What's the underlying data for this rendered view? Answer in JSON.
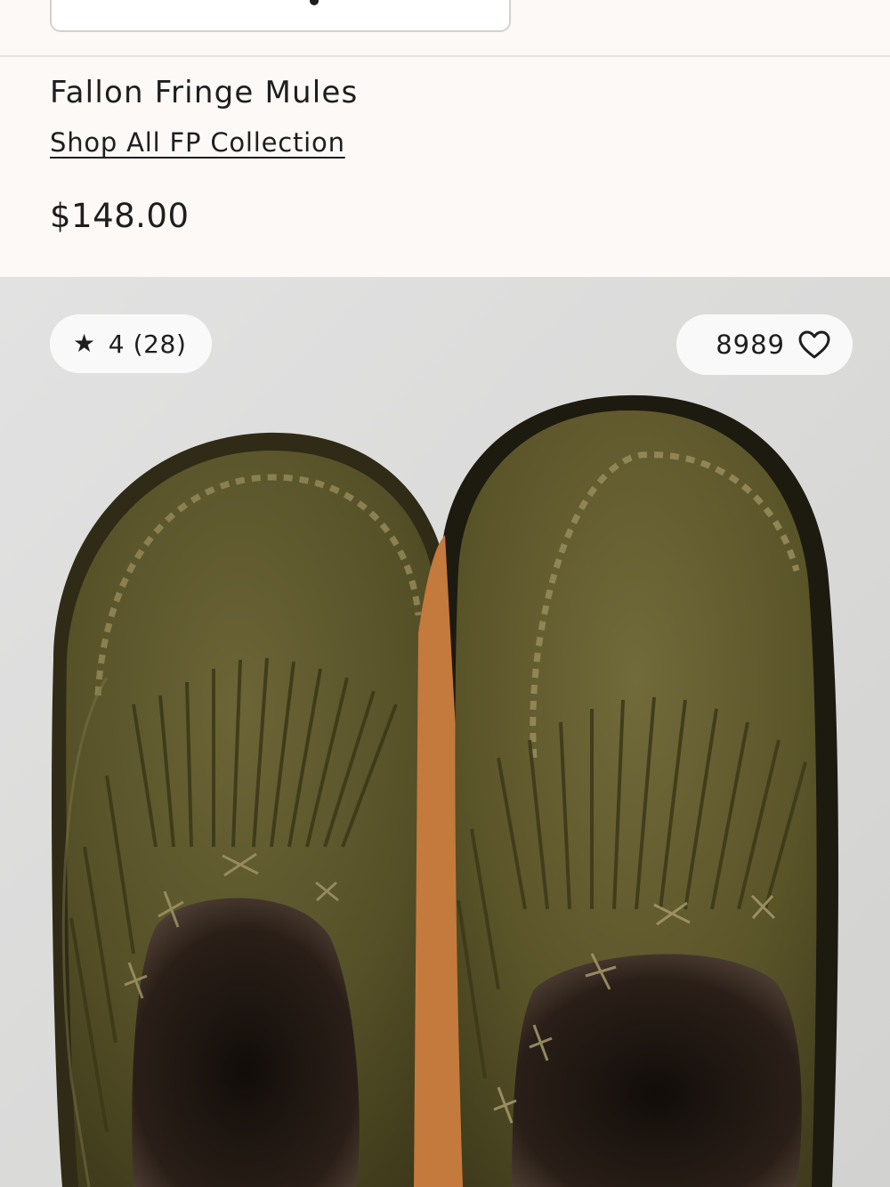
{
  "product": {
    "title": "Fallon Fringe Mules",
    "collection_link": "Shop All FP Collection",
    "price": "$148.00"
  },
  "rating": {
    "star_icon": "star-icon",
    "text": "4 (28)"
  },
  "favorites": {
    "count": "8989",
    "icon": "heart-outline-icon"
  },
  "colors": {
    "page_background": "#fcf9f7",
    "suede": "#4f4a26",
    "sole": "#c47a3c"
  }
}
